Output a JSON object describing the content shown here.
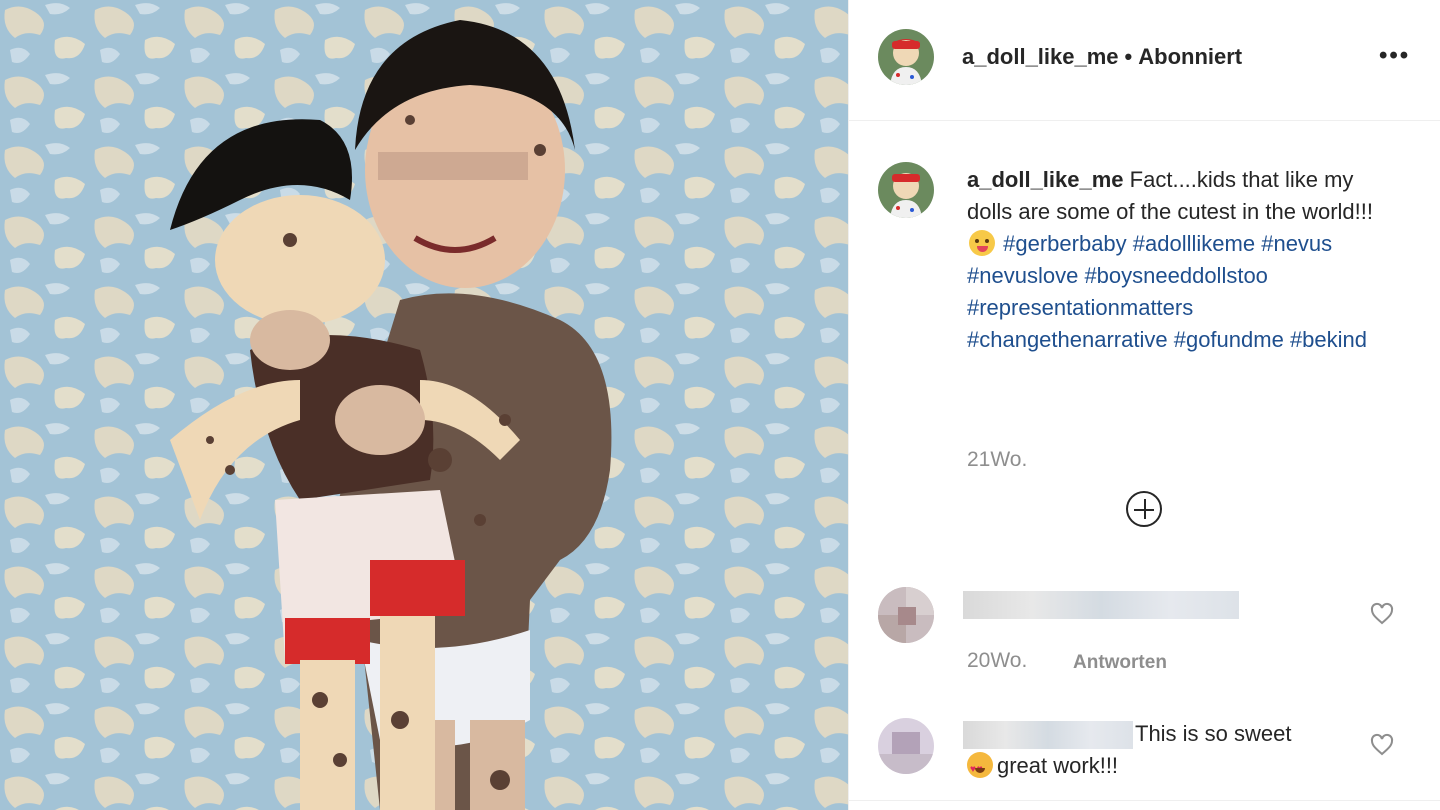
{
  "post": {
    "username": "a_doll_like_me",
    "separator": "•",
    "follow_status": "Abonniert",
    "more_label": "•••"
  },
  "caption": {
    "username": "a_doll_like_me",
    "text_part1": "Fact....kids that like my dolls are some of the cutest in the world!!!",
    "emoji": "winking-tongue-emoji",
    "hashtags": [
      "#gerberbaby",
      "#adolllikeme",
      "#nevus",
      "#nevuslove",
      "#boysneeddollstoo",
      "#representationmatters",
      "#changethenarrative",
      "#gofundme",
      "#bekind"
    ],
    "time": "21Wo."
  },
  "comments": [
    {
      "time": "20Wo.",
      "reply_label": "Antworten"
    },
    {
      "text": "This is so sweet",
      "emoji": "heart-eyes-cat-emoji",
      "text2": "great work!!!"
    }
  ],
  "colors": {
    "hashtag": "#1f4f8e",
    "muted": "#8e8e8e",
    "text": "#262626",
    "wall": "#a9c7d8"
  }
}
